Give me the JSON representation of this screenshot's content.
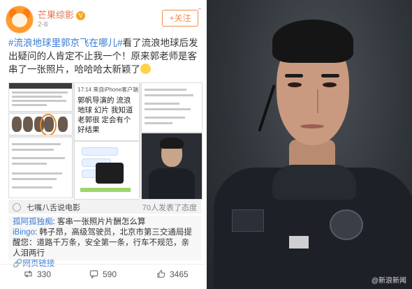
{
  "post": {
    "author": "芒果综影",
    "verified_badge": "V",
    "date": "2-8",
    "follow_label": "+关注",
    "topic_tag": "#流浪地球里郭京飞在哪儿#",
    "body": "看了流浪地球后发出疑问的人肯定不止我一个！原来郭老师是客串了一张照片，哈哈哈太新颖了",
    "screenshot_time": "17:14 来自iPhone客户端",
    "screenshot_text": "郭帆导演的 流浪地球 幻片 我知道老郭很 定会有个好结果"
  },
  "repost": {
    "source": "七嘴八舌说电影",
    "count_text": "70人发表了态度"
  },
  "comments": [
    {
      "user": "孤阿孤独痴",
      "text": "客串一张照片片酬怎么算"
    },
    {
      "user": "iBingo",
      "text": "韩子昂，高级驾驶员，北京市第三交通局提醒您：道路千万条，安全第一条，行车不规范，亲人泪两行"
    }
  ],
  "web_link_label": "网页链接",
  "footer": {
    "reposts": "330",
    "comments": "590",
    "likes": "3465"
  },
  "watermark": "@新浪新闻",
  "colors": {
    "accent": "#eb7350",
    "link": "#3a7bd5"
  }
}
